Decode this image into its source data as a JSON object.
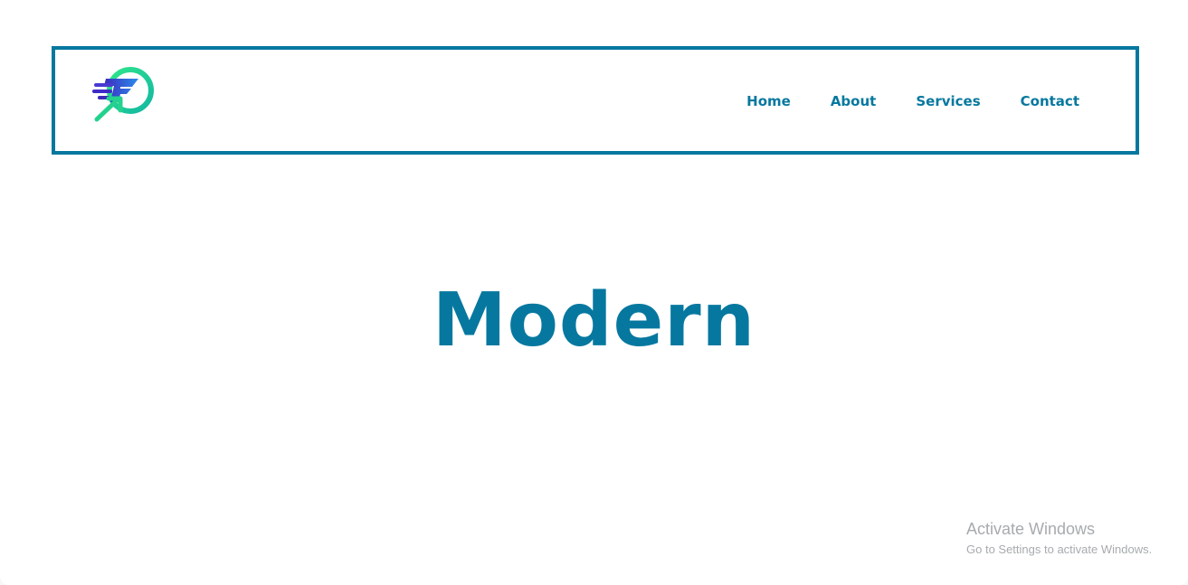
{
  "header": {
    "nav_items": [
      {
        "label": "Home"
      },
      {
        "label": "About"
      },
      {
        "label": "Services"
      },
      {
        "label": "Contact"
      }
    ]
  },
  "hero": {
    "title": "Modern"
  },
  "windows_activation": {
    "title": "Activate Windows",
    "subtitle": "Go to Settings to activate Windows."
  },
  "theme": {
    "accent": "#06789f",
    "logo_green": "#24d28e",
    "logo_blue": "#3d43c7"
  }
}
